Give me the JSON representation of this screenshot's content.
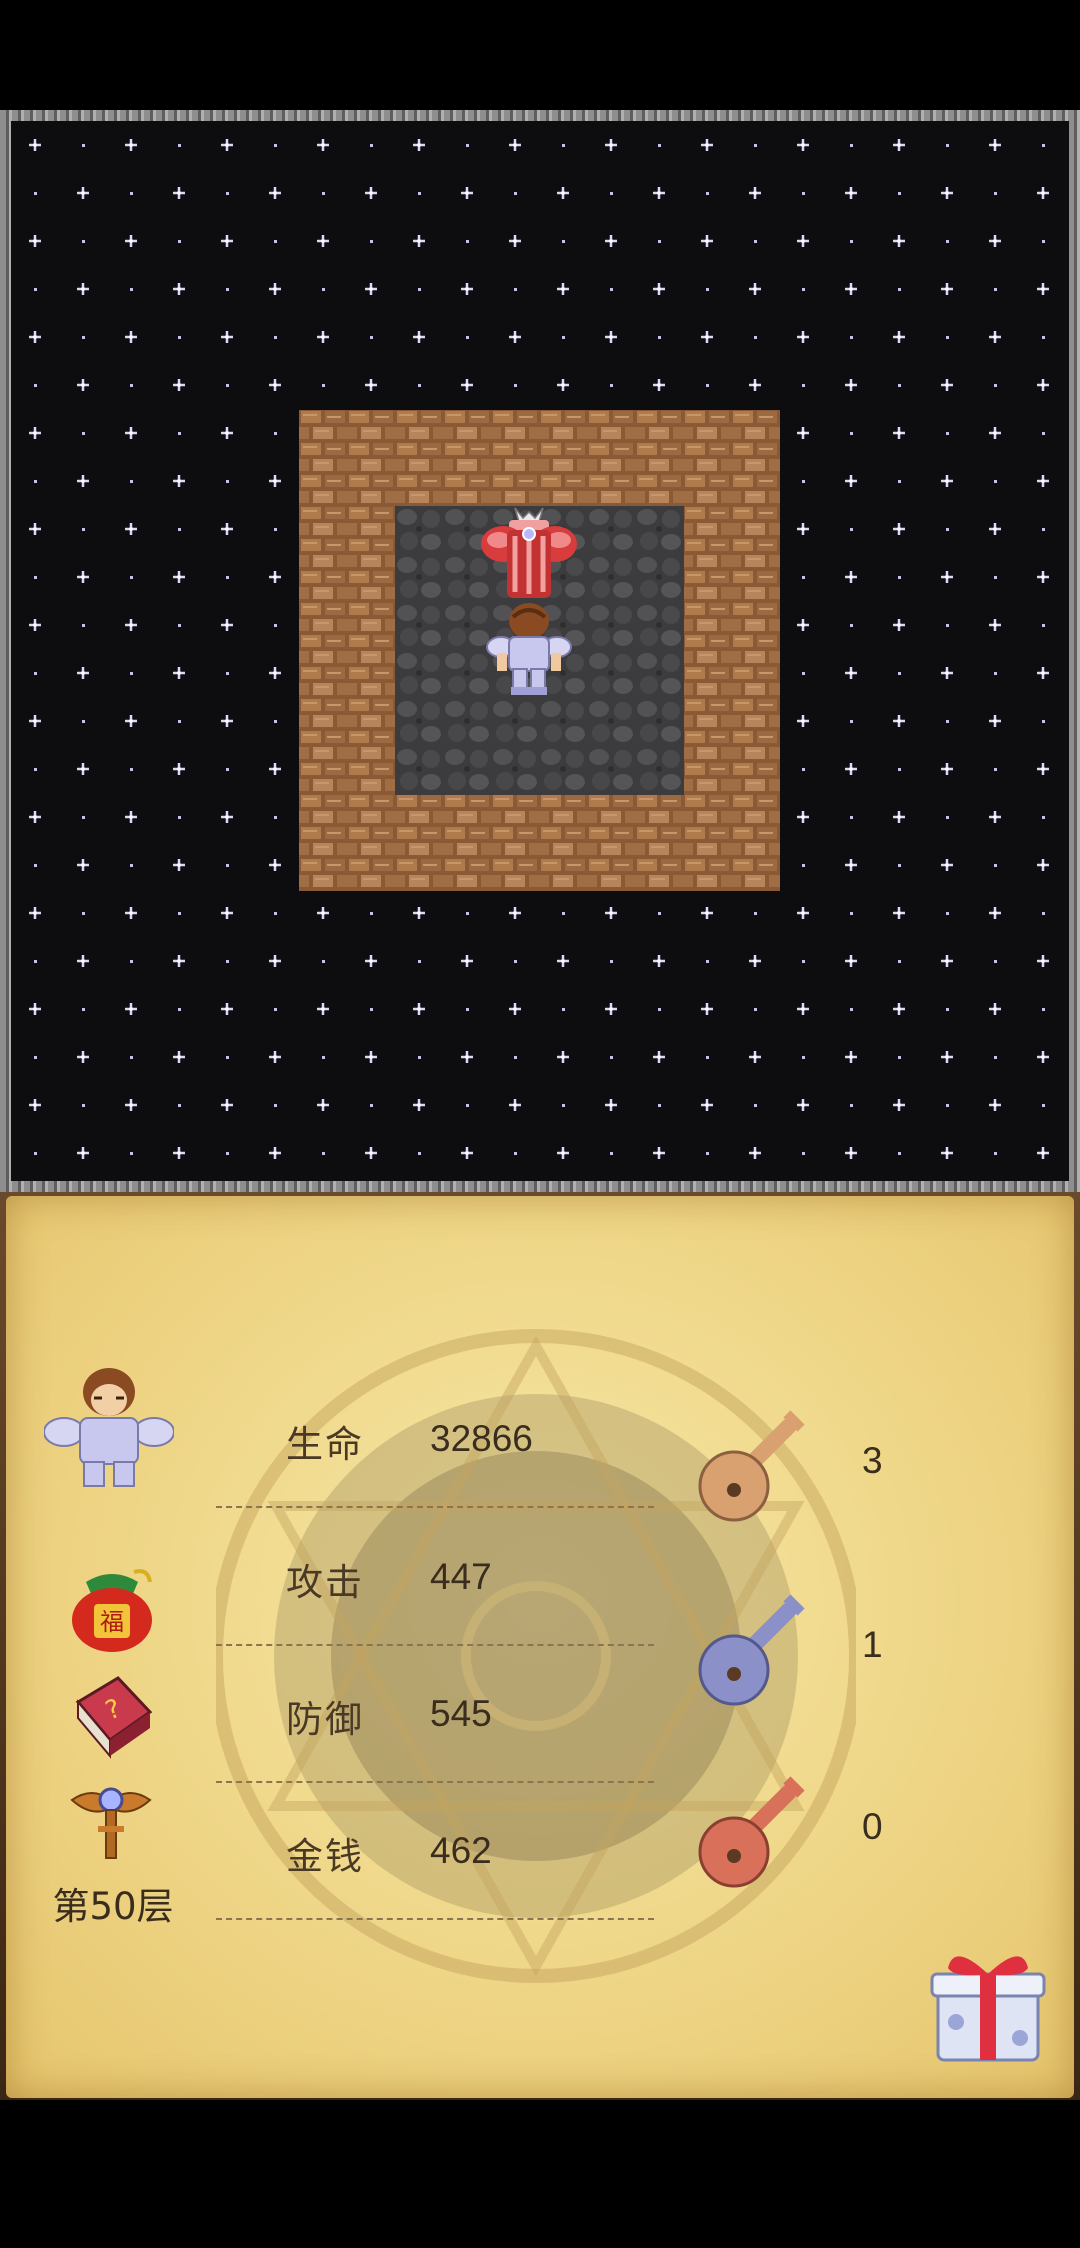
{
  "stats": [
    {
      "label": "生命",
      "value": "32866"
    },
    {
      "label": "攻击",
      "value": "447"
    },
    {
      "label": "防御",
      "value": "545"
    },
    {
      "label": "金钱",
      "value": "462"
    }
  ],
  "keys": {
    "yellow": {
      "count": "3",
      "color": "#d9a070"
    },
    "blue": {
      "count": "1",
      "color": "#8c90c8"
    },
    "red": {
      "count": "0",
      "color": "#d8705a"
    }
  },
  "floor": {
    "label": "第50层"
  },
  "colors": {
    "panel_bg": "#f0d98c",
    "board_bg": "#0d0d10",
    "wall": "#8a5a36",
    "floor_tile": "#4a4a4c"
  },
  "icons": {
    "hero_portrait": "hero-portrait-icon",
    "lucky_bag": "lucky-bag-icon",
    "monster_manual": "monster-manual-icon",
    "fly_staff": "floor-fly-staff-icon",
    "gift": "gift-box-icon"
  }
}
